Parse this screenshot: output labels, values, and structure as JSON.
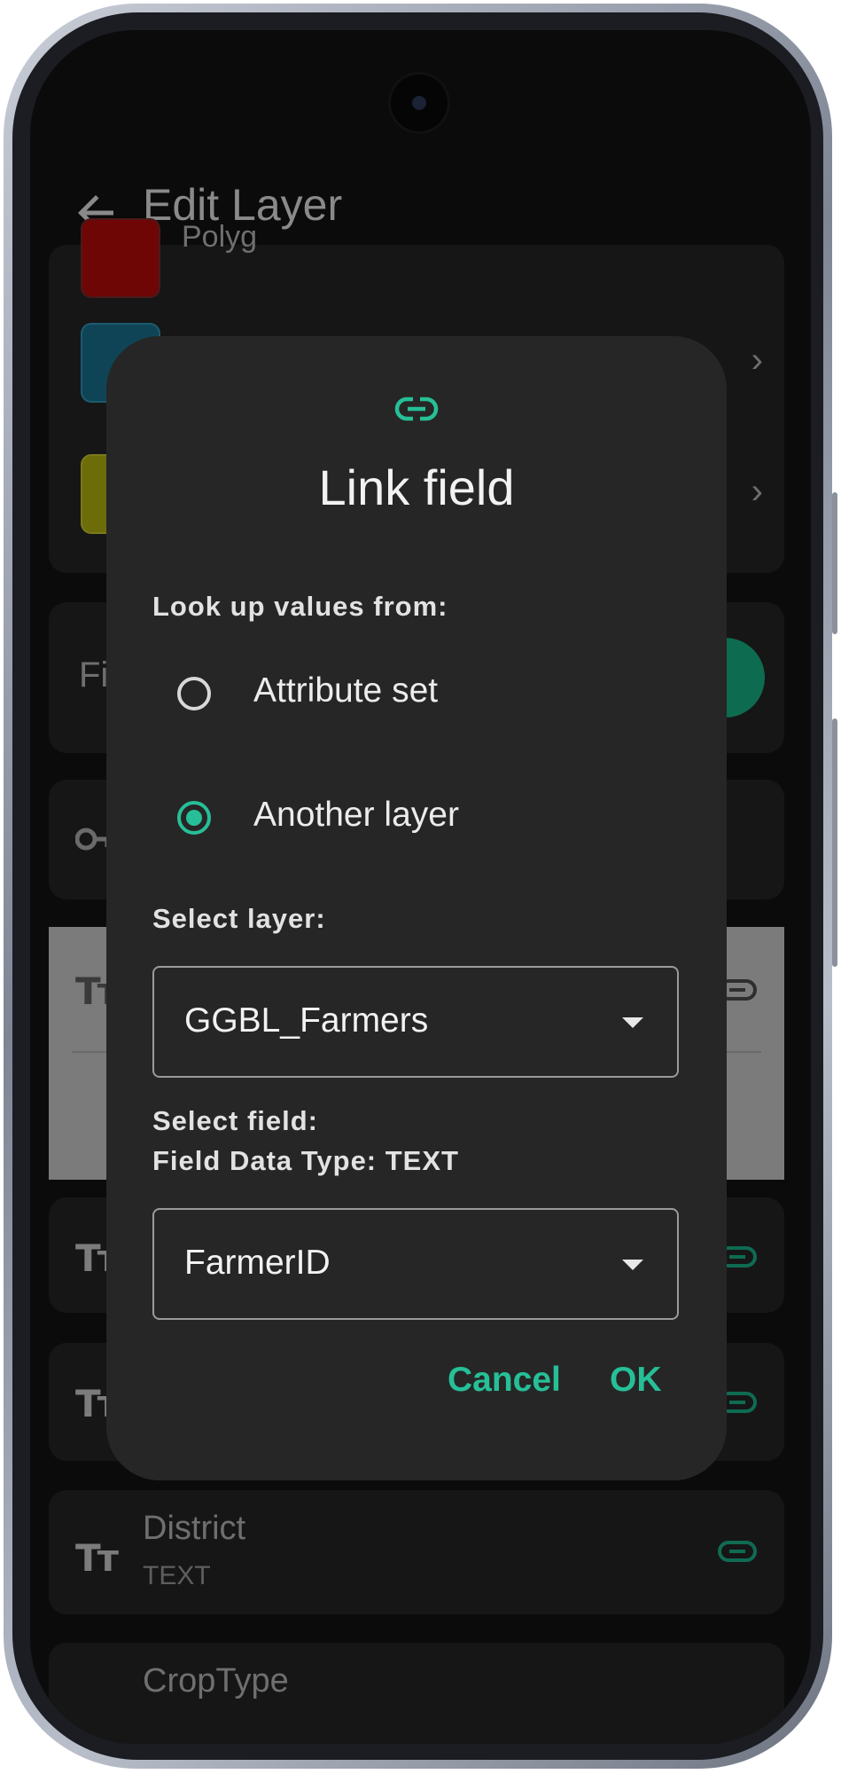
{
  "appbar": {
    "title": "Edit Layer",
    "back_icon": "arrow-left-icon"
  },
  "background": {
    "style_items": [
      {
        "color": "#8b0000",
        "label": "Polyg"
      },
      {
        "color": "#0f4e66"
      },
      {
        "color": "#8c8c0a"
      }
    ],
    "fields_header": "Fi",
    "fields": [
      {
        "name": "District",
        "type": "TEXT"
      },
      {
        "name": "CropType"
      }
    ]
  },
  "dialog": {
    "icon": "link-icon",
    "title": "Link field",
    "lookup_label": "Look up values from:",
    "options": [
      {
        "label": "Attribute set",
        "checked": false
      },
      {
        "label": "Another layer",
        "checked": true
      }
    ],
    "select_layer_label": "Select layer:",
    "layer_value": "GGBL_Farmers",
    "select_field_label": "Select field:",
    "field_type_label": "Field Data Type: TEXT",
    "field_value": "FarmerID",
    "cancel_label": "Cancel",
    "ok_label": "OK"
  },
  "colors": {
    "accent": "#26bf97",
    "dialog_bg": "#262626",
    "screen_bg": "#0b0b0b"
  }
}
